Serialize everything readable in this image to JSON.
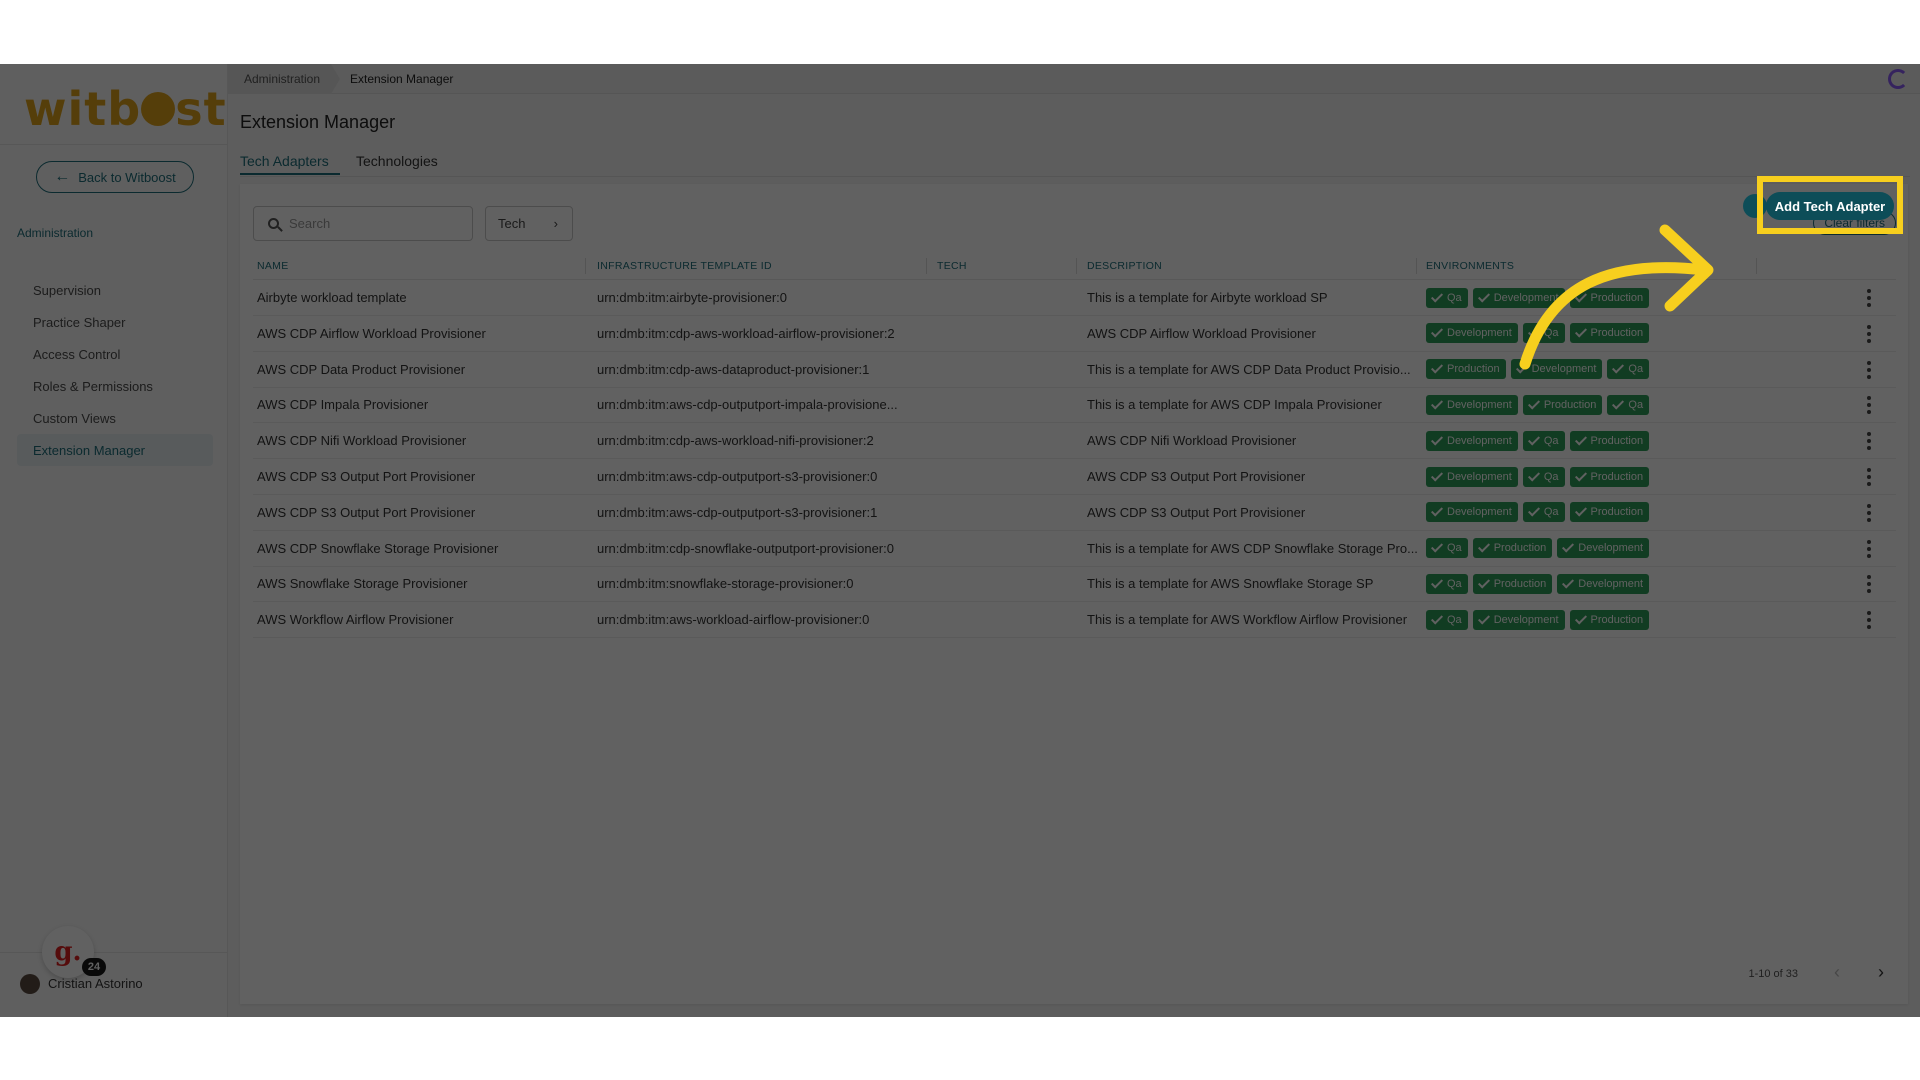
{
  "sidebar": {
    "logo_text": "witboost",
    "back_label": "Back to Witboost",
    "section_label": "Administration",
    "items": [
      {
        "label": "Supervision",
        "active": false
      },
      {
        "label": "Practice Shaper",
        "active": false
      },
      {
        "label": "Access Control",
        "active": false
      },
      {
        "label": "Roles & Permissions",
        "active": false
      },
      {
        "label": "Custom Views",
        "active": false
      },
      {
        "label": "Extension Manager",
        "active": true
      }
    ],
    "user_name": "Cristian Astorino",
    "badge_letter": "g.",
    "badge_count": "24"
  },
  "breadcrumb": [
    "Administration",
    "Extension Manager"
  ],
  "page_title": "Extension Manager",
  "tabs": [
    {
      "label": "Tech Adapters",
      "active": true
    },
    {
      "label": "Technologies",
      "active": false
    }
  ],
  "toolbar": {
    "search_placeholder": "Search",
    "tech_filter_label": "Tech",
    "clear_filters_label": "Clear filters",
    "add_button_label": "Add Tech Adapter"
  },
  "table": {
    "columns": [
      "Name",
      "Infrastructure Template ID",
      "Tech",
      "Description",
      "Environments"
    ],
    "rows": [
      {
        "name": "Airbyte workload template",
        "template_id": "urn:dmb:itm:airbyte-provisioner:0",
        "tech": "",
        "description": "This is a template for Airbyte workload SP",
        "environments": [
          "Qa",
          "Development",
          "Production"
        ]
      },
      {
        "name": "AWS CDP Airflow Workload Provisioner",
        "template_id": "urn:dmb:itm:cdp-aws-workload-airflow-provisioner:2",
        "tech": "",
        "description": "AWS CDP Airflow Workload Provisioner",
        "environments": [
          "Development",
          "Qa",
          "Production"
        ]
      },
      {
        "name": "AWS CDP Data Product Provisioner",
        "template_id": "urn:dmb:itm:cdp-aws-dataproduct-provisioner:1",
        "tech": "",
        "description": "This is a template for AWS CDP Data Product Provisio...",
        "environments": [
          "Production",
          "Development",
          "Qa"
        ]
      },
      {
        "name": "AWS CDP Impala Provisioner",
        "template_id": "urn:dmb:itm:aws-cdp-outputport-impala-provisione...",
        "tech": "",
        "description": "This is a template for AWS CDP Impala Provisioner",
        "environments": [
          "Development",
          "Production",
          "Qa"
        ]
      },
      {
        "name": "AWS CDP Nifi Workload Provisioner",
        "template_id": "urn:dmb:itm:cdp-aws-workload-nifi-provisioner:2",
        "tech": "",
        "description": "AWS CDP Nifi Workload Provisioner",
        "environments": [
          "Development",
          "Qa",
          "Production"
        ]
      },
      {
        "name": "AWS CDP S3 Output Port Provisioner",
        "template_id": "urn:dmb:itm:aws-cdp-outputport-s3-provisioner:0",
        "tech": "",
        "description": "AWS CDP S3 Output Port Provisioner",
        "environments": [
          "Development",
          "Qa",
          "Production"
        ]
      },
      {
        "name": "AWS CDP S3 Output Port Provisioner",
        "template_id": "urn:dmb:itm:aws-cdp-outputport-s3-provisioner:1",
        "tech": "",
        "description": "AWS CDP S3 Output Port Provisioner",
        "environments": [
          "Development",
          "Qa",
          "Production"
        ]
      },
      {
        "name": "AWS CDP Snowflake Storage Provisioner",
        "template_id": "urn:dmb:itm:cdp-snowflake-outputport-provisioner:0",
        "tech": "",
        "description": "This is a template for AWS CDP Snowflake Storage Pro...",
        "environments": [
          "Qa",
          "Production",
          "Development"
        ]
      },
      {
        "name": "AWS Snowflake Storage Provisioner",
        "template_id": "urn:dmb:itm:snowflake-storage-provisioner:0",
        "tech": "",
        "description": "This is a template for AWS Snowflake Storage SP",
        "environments": [
          "Qa",
          "Production",
          "Development"
        ]
      },
      {
        "name": "AWS Workflow Airflow Provisioner",
        "template_id": "urn:dmb:itm:aws-workload-airflow-provisioner:0",
        "tech": "",
        "description": "This is a template for AWS Workflow Airflow Provisioner",
        "environments": [
          "Qa",
          "Development",
          "Production"
        ]
      }
    ]
  },
  "pagination": {
    "range_label": "1-10 of 33"
  },
  "icons": {
    "back": "arrow-left-icon",
    "search": "search-icon",
    "filter_chevron": "chevron-right-icon",
    "env_check": "check-icon",
    "row_menu": "kebab-menu-icon",
    "prev": "chevron-left-icon",
    "next": "chevron-right-icon",
    "top_right": "loading-ring-icon"
  },
  "colors": {
    "accent": "#1f6e7b",
    "logo": "#e0a21b",
    "chip": "#2e9e5a",
    "highlight": "#f7cf1e",
    "add_button": "#0d4d58"
  }
}
